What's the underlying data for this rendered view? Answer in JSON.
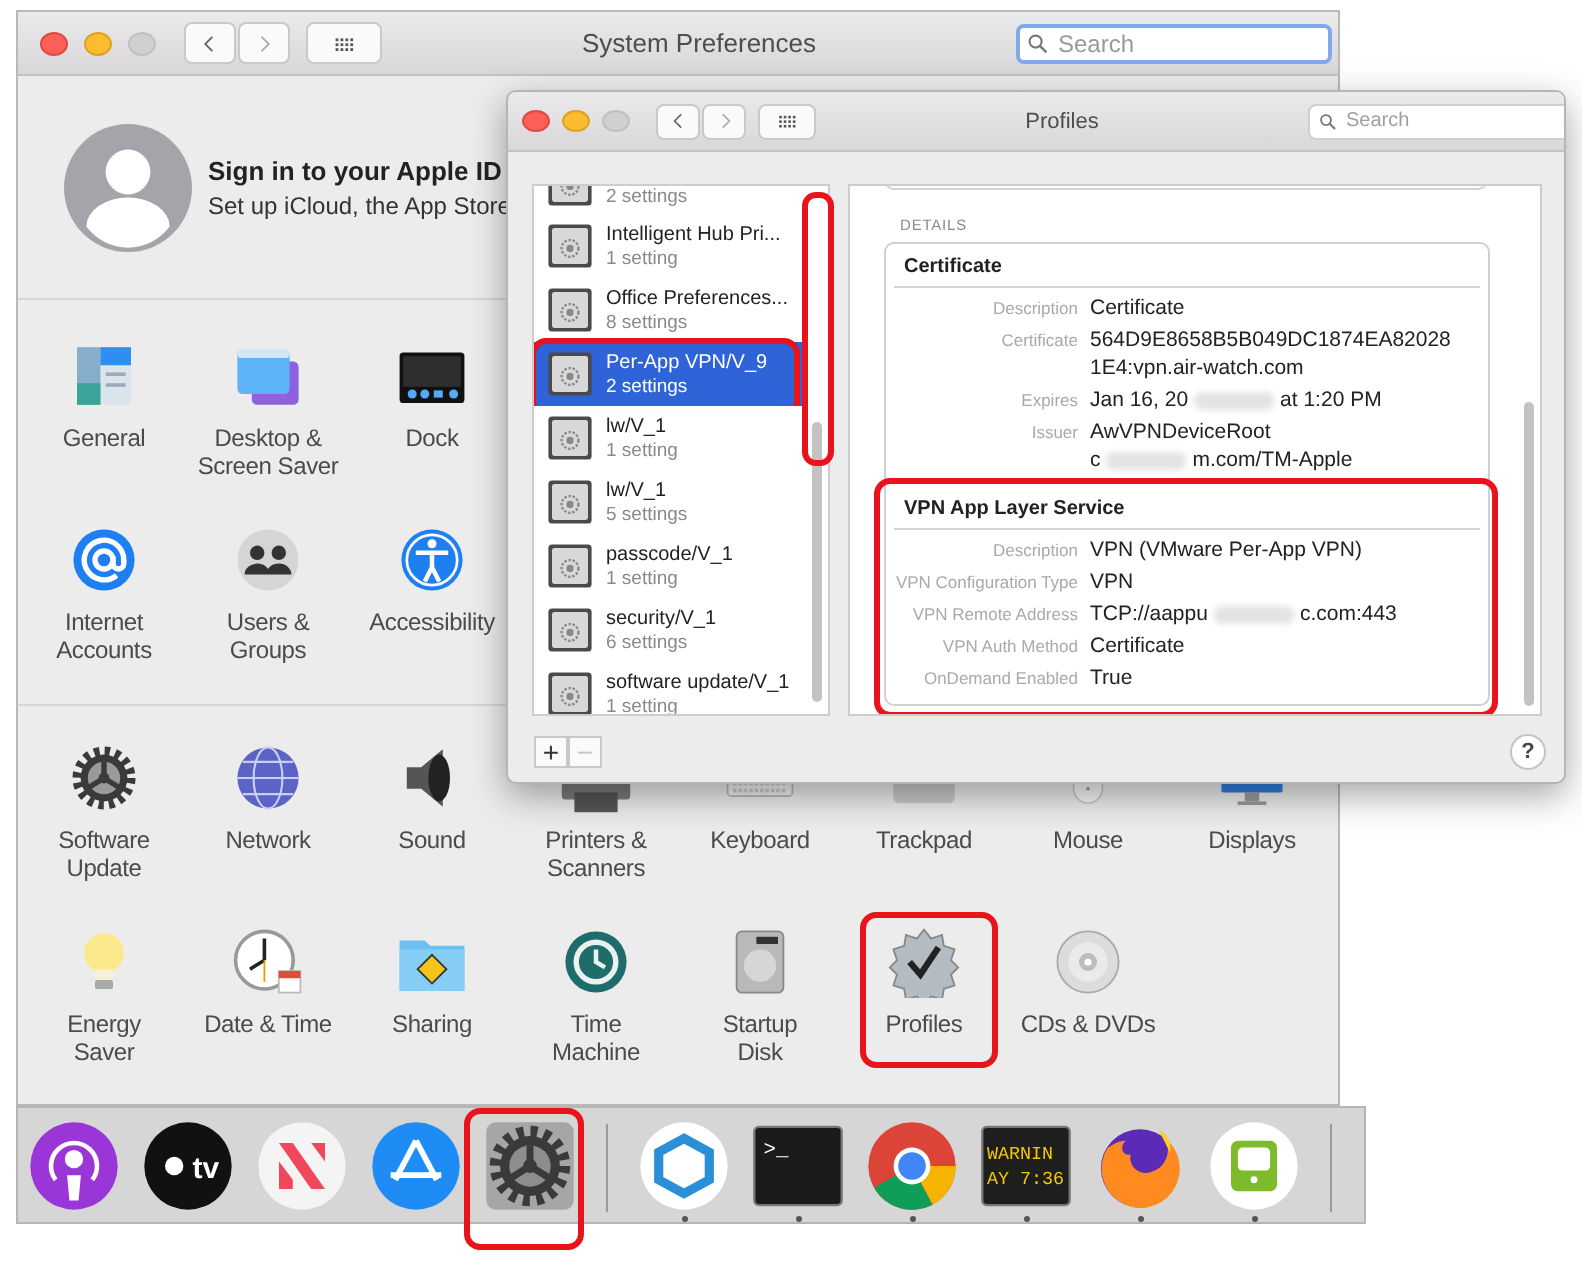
{
  "window": {
    "title": "System Preferences",
    "search": {
      "placeholder": "Search",
      "focused": true
    }
  },
  "apple_id": {
    "title": "Sign in to your Apple ID",
    "subtitle": "Set up iCloud, the App Store"
  },
  "sections": [
    {
      "rows": [
        [
          {
            "label": "General",
            "highlighted": false
          },
          {
            "label": "Desktop &\nScreen Saver",
            "highlighted": false
          },
          {
            "label": "Dock",
            "highlighted": false
          }
        ],
        [
          {
            "label": "Internet\nAccounts",
            "highlighted": false
          },
          {
            "label": "Users &\nGroups",
            "highlighted": false
          },
          {
            "label": "Accessibility",
            "highlighted": false
          }
        ]
      ]
    },
    {
      "rows": [
        [
          {
            "label": "Software\nUpdate",
            "highlighted": false
          },
          {
            "label": "Network",
            "highlighted": false
          },
          {
            "label": "Sound",
            "highlighted": false
          },
          {
            "label": "Printers &\nScanners",
            "highlighted": false
          },
          {
            "label": "Keyboard",
            "highlighted": false
          },
          {
            "label": "Trackpad",
            "highlighted": false
          },
          {
            "label": "Mouse",
            "highlighted": false
          },
          {
            "label": "Displays",
            "highlighted": false
          }
        ],
        [
          {
            "label": "Energy\nSaver",
            "highlighted": false
          },
          {
            "label": "Date & Time",
            "highlighted": false
          },
          {
            "label": "Sharing",
            "highlighted": false
          },
          {
            "label": "Time\nMachine",
            "highlighted": false
          },
          {
            "label": "Startup\nDisk",
            "highlighted": false
          },
          {
            "label": "Profiles",
            "highlighted": true
          },
          {
            "label": "CDs & DVDs",
            "highlighted": false
          }
        ]
      ]
    }
  ],
  "profiles_window": {
    "title": "Profiles",
    "search": {
      "placeholder": "Search"
    },
    "list": {
      "scroll_highlighted": true,
      "items": [
        {
          "settings": "2 settings",
          "selected": false,
          "highlighted": false
        },
        {
          "name": "Intelligent Hub Pri...",
          "settings": "1 setting",
          "selected": false,
          "highlighted": false
        },
        {
          "name": "Office Preferences...",
          "settings": "8 settings",
          "selected": false,
          "highlighted": false
        },
        {
          "name": "Per-App VPN/V_9",
          "settings": "2 settings",
          "selected": true,
          "highlighted": true
        },
        {
          "name": "lw/V_1",
          "settings": "1 setting",
          "selected": false,
          "highlighted": false
        },
        {
          "name": "lw/V_1",
          "settings": "5 settings",
          "selected": false,
          "highlighted": false
        },
        {
          "name": "passcode/V_1",
          "settings": "1 setting",
          "selected": false,
          "highlighted": false
        },
        {
          "name": "security/V_1",
          "settings": "6 settings",
          "selected": false,
          "highlighted": false
        },
        {
          "name": "software update/V_1",
          "settings": "1 setting",
          "selected": false,
          "highlighted": false
        }
      ]
    },
    "list_buttons": [
      {
        "label": "+",
        "disabled": false
      },
      {
        "label": "−",
        "disabled": true
      }
    ],
    "details": {
      "heading": "DETAILS",
      "sections": [
        {
          "title": "Certificate",
          "highlighted": false,
          "rows": [
            {
              "label": "Description",
              "value": [
                [
                  "Certificate"
                ]
              ]
            },
            {
              "label": "Certificate",
              "value": [
                [
                  "564D9E8658B5B049DC1874EA82028"
                ],
                [
                  "1E4:vpn.air-watch.com"
                ]
              ]
            },
            {
              "label": "Expires",
              "value": [
                [
                  "Jan 16, 20",
                  "at 1:20 PM"
                ]
              ]
            },
            {
              "label": "Issuer",
              "value": [
                [
                  "AwVPNDeviceRoot"
                ],
                [
                  "c",
                  "m.com/TM-Apple"
                ]
              ]
            }
          ]
        },
        {
          "title": "VPN App Layer Service",
          "highlighted": true,
          "rows": [
            {
              "label": "Description",
              "value": [
                [
                  "VPN (VMware Per-App VPN)"
                ]
              ]
            },
            {
              "label": "VPN Configuration Type",
              "value": [
                [
                  "VPN"
                ]
              ]
            },
            {
              "label": "VPN Remote Address",
              "value": [
                [
                  "TCP://aappu",
                  "c.com:443"
                ]
              ]
            },
            {
              "label": "VPN Auth Method",
              "value": [
                [
                  "Certificate"
                ]
              ]
            },
            {
              "label": "OnDemand Enabled",
              "value": [
                [
                  "True"
                ]
              ]
            }
          ]
        }
      ]
    },
    "help": "?"
  },
  "dock": {
    "groups": [
      [
        {
          "running": false,
          "highlighted": false
        },
        {
          "running": false,
          "highlighted": false,
          "icon_text": [
            "tv"
          ]
        },
        {
          "running": false,
          "highlighted": false
        },
        {
          "running": false,
          "highlighted": false
        },
        {
          "running": false,
          "highlighted": true
        }
      ],
      [
        {
          "running": true,
          "highlighted": false
        },
        {
          "running": true,
          "highlighted": false,
          "icon_text": [
            ">_"
          ]
        },
        {
          "running": true,
          "highlighted": false
        },
        {
          "running": true,
          "highlighted": false,
          "icon_text": [
            "WARNIN",
            "AY 7:36"
          ]
        },
        {
          "running": true,
          "highlighted": false
        },
        {
          "running": true,
          "highlighted": false
        }
      ]
    ]
  }
}
